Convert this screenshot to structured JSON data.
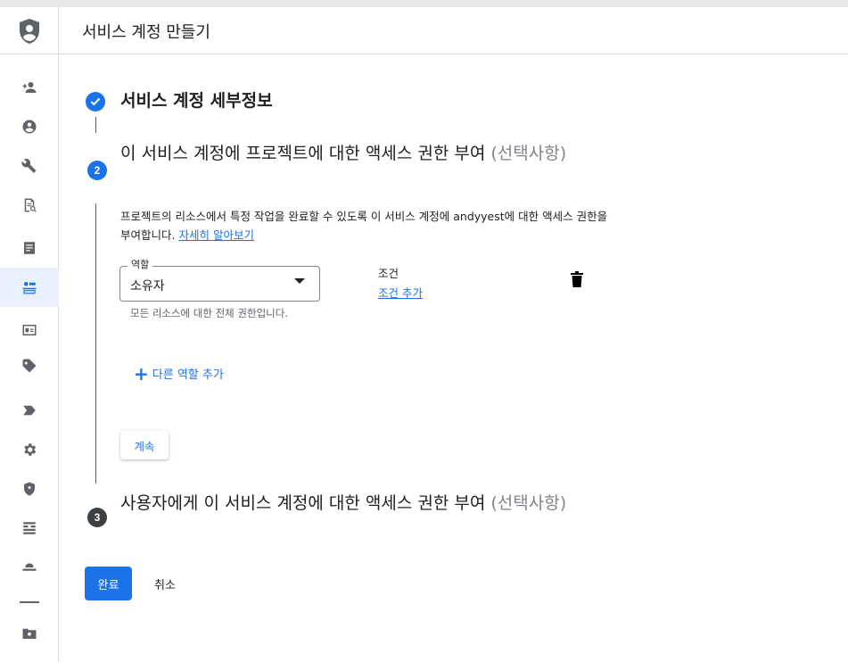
{
  "header": {
    "title": "서비스 계정 만들기"
  },
  "rail": {
    "items": [
      {
        "icon": "person-add-icon"
      },
      {
        "icon": "account-circle-icon"
      },
      {
        "icon": "wrench-icon"
      },
      {
        "icon": "document-search-icon"
      },
      {
        "icon": "note-icon"
      },
      {
        "icon": "service-accounts-icon",
        "active": true
      },
      {
        "icon": "id-card-icon"
      },
      {
        "icon": "tag-icon"
      },
      {
        "icon": "chevron-tag-icon"
      },
      {
        "icon": "gear-icon"
      },
      {
        "icon": "shield-icon"
      },
      {
        "icon": "layout-icon"
      },
      {
        "icon": "hat-icon"
      },
      {
        "icon": "folder-settings-icon"
      }
    ]
  },
  "steps": {
    "step1": {
      "title": "서비스 계정 세부정보"
    },
    "step2": {
      "number": "2",
      "title": "이 서비스 계정에 프로젝트에 대한 액세스 권한 부여",
      "optional": " (선택사항)",
      "description": "프로젝트의 리소스에서 특정 작업을 완료할 수 있도록 이 서비스 계정에 andyyest에 대한 액세스 권한을 부여합니다.",
      "learn_more": "자세히 알아보기",
      "role_label": "역할",
      "role_value": "소유자",
      "role_help": "모든 리소스에 대한 전체 권한입니다.",
      "condition_label": "조건",
      "add_condition": "조건 추가",
      "add_role": "다른 역할 추가",
      "continue": "계속"
    },
    "step3": {
      "number": "3",
      "title": "사용자에게 이 서비스 계정에 대한 액세스 권한 부여",
      "optional": " (선택사항)"
    }
  },
  "actions": {
    "done": "완료",
    "cancel": "취소"
  },
  "colors": {
    "accent": "#1a73e8",
    "active_rail_bg": "#e8f0fe"
  }
}
